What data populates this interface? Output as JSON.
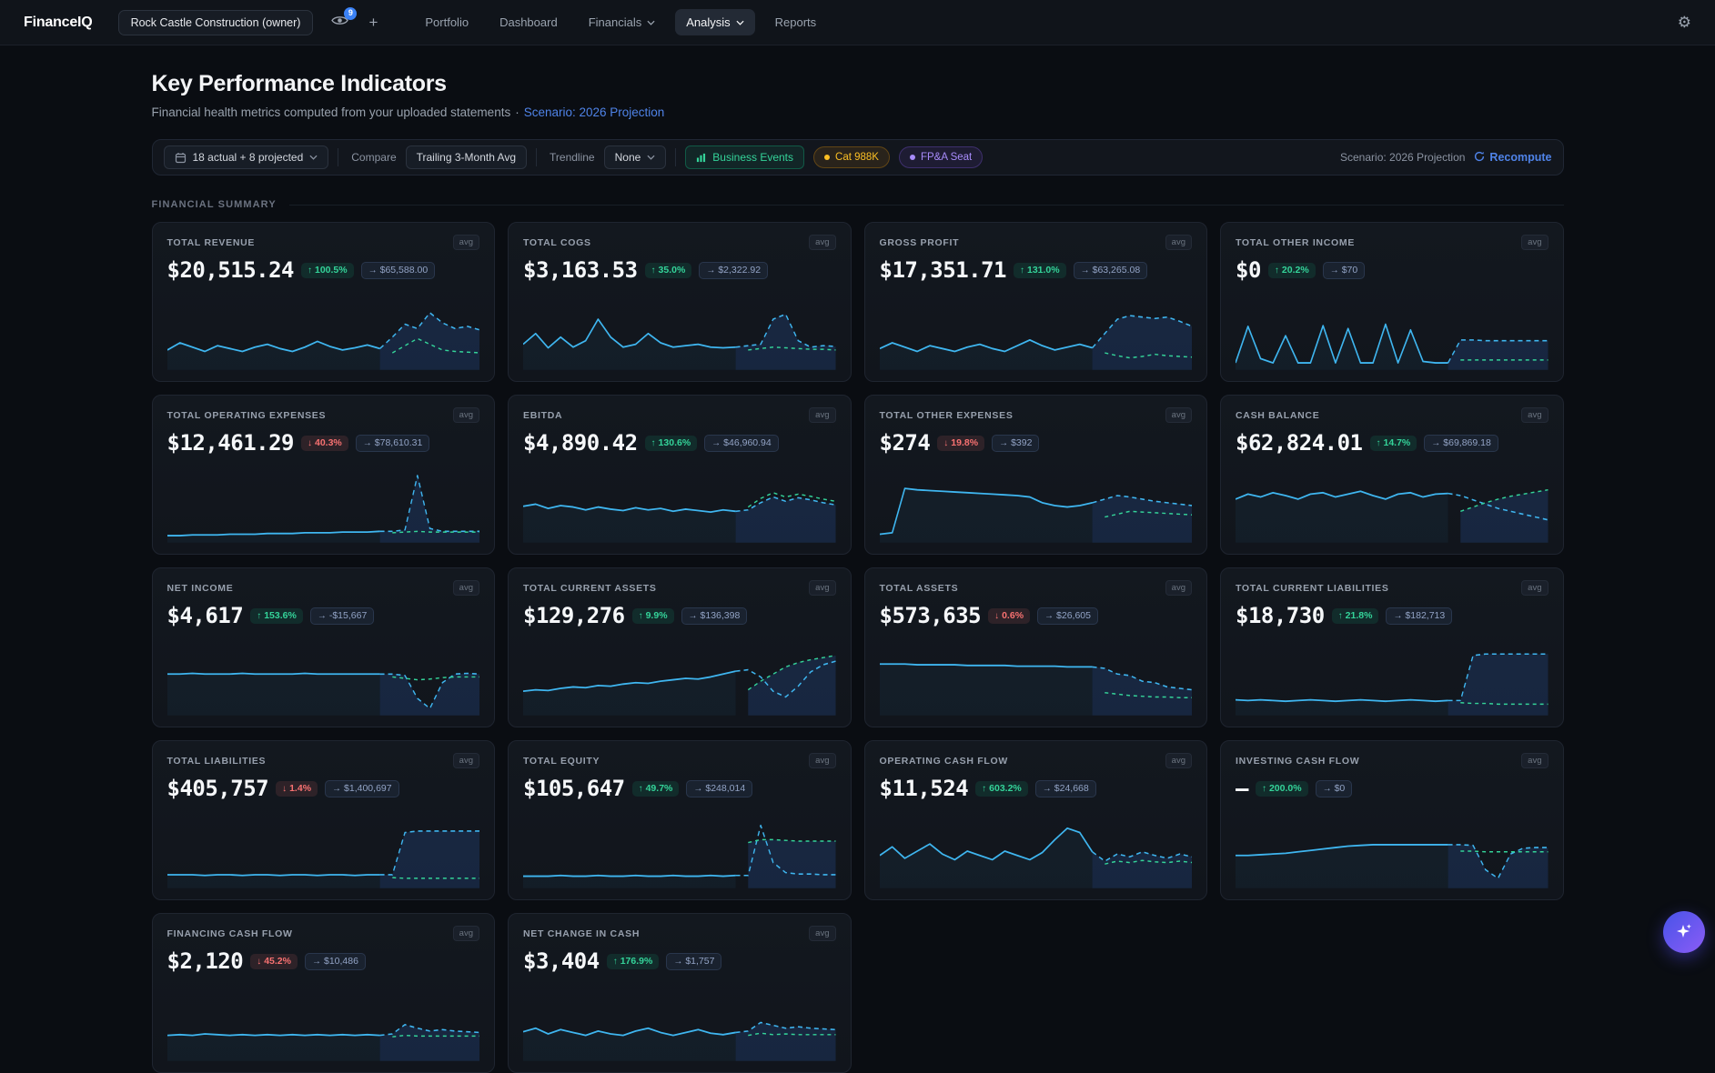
{
  "nav": {
    "brand": "FinanceIQ",
    "company": "Rock Castle Construction (owner)",
    "eye_badge": "9",
    "plus": "+",
    "items": [
      {
        "label": "Portfolio",
        "active": false,
        "caret": false
      },
      {
        "label": "Dashboard",
        "active": false,
        "caret": false
      },
      {
        "label": "Financials",
        "active": false,
        "caret": true
      },
      {
        "label": "Analysis",
        "active": true,
        "caret": true
      },
      {
        "label": "Reports",
        "active": false,
        "caret": false
      }
    ]
  },
  "header": {
    "title": "Key Performance Indicators",
    "subtitle": "Financial health metrics computed from your uploaded statements",
    "separator": "·",
    "scenario_link": "Scenario: 2026 Projection"
  },
  "toolbar": {
    "period": "18 actual + 8 projected",
    "compare_label": "Compare",
    "compare_value": "Trailing 3-Month Avg",
    "trendline_label": "Trendline",
    "trendline_value": "None",
    "business_events": "Business Events",
    "badge_cat": "Cat 988K",
    "badge_fpa": "FP&A Seat",
    "scenario_text": "Scenario: 2026 Projection",
    "recompute": "Recompute"
  },
  "section": {
    "label": "FINANCIAL SUMMARY"
  },
  "colors": {
    "accent_blue": "#4f83e8",
    "green": "#34d399",
    "red": "#f87171",
    "amber": "#fbbf24",
    "purple": "#a78bfa",
    "spark_cyan": "#3fb6f0",
    "spark_green": "#34d399",
    "proj_fill": "rgba(59,130,246,0.16)"
  },
  "cards": [
    {
      "title": "TOTAL REVENUE",
      "avg": "avg",
      "value": "$20,515.24",
      "change": {
        "dir": "up",
        "arrow": "↑",
        "label": "100.5%"
      },
      "compare": {
        "arrow": "→",
        "label": "$65,588.00"
      },
      "spark": {
        "actual": [
          22,
          32,
          26,
          20,
          28,
          24,
          20,
          26,
          30,
          24,
          20,
          26,
          34,
          27,
          22,
          25,
          29,
          24
        ],
        "proj": [
          40,
          58,
          52,
          74,
          60,
          52,
          55,
          50
        ],
        "green": [
          18,
          28,
          38,
          30,
          22,
          20,
          19,
          18
        ]
      }
    },
    {
      "title": "TOTAL COGS",
      "avg": "avg",
      "value": "$3,163.53",
      "change": {
        "dir": "up",
        "arrow": "↑",
        "label": "35.0%"
      },
      "compare": {
        "arrow": "→",
        "label": "$2,322.92"
      },
      "spark": {
        "actual": [
          30,
          45,
          25,
          40,
          26,
          35,
          65,
          40,
          26,
          30,
          45,
          32,
          26,
          28,
          30,
          26,
          25,
          26
        ],
        "proj": [
          28,
          30,
          65,
          72,
          35,
          26,
          28,
          27
        ],
        "green": [
          22,
          24,
          26,
          25,
          24,
          23,
          23,
          22
        ]
      }
    },
    {
      "title": "GROSS PROFIT",
      "avg": "avg",
      "value": "$17,351.71",
      "change": {
        "dir": "up",
        "arrow": "↑",
        "label": "131.0%"
      },
      "compare": {
        "arrow": "→",
        "label": "$63,265.08"
      },
      "spark": {
        "actual": [
          24,
          32,
          26,
          20,
          28,
          24,
          20,
          26,
          30,
          24,
          20,
          28,
          36,
          28,
          22,
          26,
          30,
          25
        ],
        "proj": [
          45,
          65,
          70,
          68,
          66,
          68,
          62,
          55
        ],
        "green": [
          18,
          14,
          11,
          13,
          16,
          14,
          13,
          12
        ]
      }
    },
    {
      "title": "TOTAL OTHER INCOME",
      "avg": "avg",
      "value": "$0",
      "change": {
        "dir": "up",
        "arrow": "↑",
        "label": "20.2%"
      },
      "compare": {
        "arrow": "→",
        "label": "$70"
      },
      "spark": {
        "actual": [
          4,
          55,
          10,
          4,
          42,
          4,
          4,
          56,
          4,
          52,
          4,
          4,
          58,
          4,
          50,
          6,
          4,
          4
        ],
        "proj": [
          36,
          36,
          35,
          35,
          35,
          35,
          35,
          35
        ],
        "green": [
          8,
          8,
          8,
          8,
          8,
          8,
          8,
          8
        ]
      }
    },
    {
      "title": "TOTAL OPERATING EXPENSES",
      "avg": "avg",
      "value": "$12,461.29",
      "change": {
        "dir": "down",
        "arrow": "↓",
        "label": "40.3%"
      },
      "compare": {
        "arrow": "→",
        "label": "$78,610.31"
      },
      "spark": {
        "actual": [
          4,
          4,
          5,
          5,
          5,
          6,
          6,
          6,
          7,
          7,
          7,
          8,
          8,
          8,
          9,
          9,
          9,
          10
        ],
        "proj": [
          10,
          12,
          88,
          14,
          10,
          10,
          10,
          10
        ],
        "green": [
          8,
          9,
          10,
          9,
          9,
          9,
          9,
          9
        ]
      }
    },
    {
      "title": "EBITDA",
      "avg": "avg",
      "value": "$4,890.42",
      "change": {
        "dir": "up",
        "arrow": "↑",
        "label": "130.6%"
      },
      "compare": {
        "arrow": "→",
        "label": "$46,960.94"
      },
      "spark": {
        "actual": [
          45,
          48,
          42,
          46,
          44,
          40,
          44,
          41,
          39,
          43,
          40,
          42,
          38,
          41,
          39,
          37,
          40,
          38
        ],
        "proj": [
          40,
          50,
          58,
          52,
          57,
          54,
          50,
          47
        ],
        "green": [
          44,
          56,
          64,
          58,
          62,
          59,
          55,
          52
        ]
      }
    },
    {
      "title": "TOTAL OTHER EXPENSES",
      "avg": "avg",
      "value": "$274",
      "change": {
        "dir": "down",
        "arrow": "↓",
        "label": "19.8%"
      },
      "compare": {
        "arrow": "→",
        "label": "$392"
      },
      "spark": {
        "actual": [
          6,
          8,
          70,
          68,
          67,
          66,
          65,
          64,
          63,
          62,
          61,
          60,
          58,
          50,
          46,
          44,
          46,
          50
        ],
        "proj": [
          55,
          60,
          58,
          55,
          52,
          50,
          48,
          46
        ],
        "green": [
          30,
          34,
          38,
          37,
          36,
          35,
          34,
          33
        ]
      }
    },
    {
      "title": "CASH BALANCE",
      "avg": "avg",
      "value": "$62,824.01",
      "change": {
        "dir": "up",
        "arrow": "↑",
        "label": "14.7%"
      },
      "compare": {
        "arrow": "→",
        "label": "$69,869.18"
      },
      "spark": {
        "actual": [
          55,
          62,
          58,
          64,
          60,
          55,
          62,
          64,
          58,
          62,
          66,
          60,
          55,
          62,
          64,
          58,
          62,
          63
        ],
        "proj": [
          60,
          54,
          48,
          42,
          38,
          34,
          30,
          26
        ],
        "green": [
          38,
          44,
          50,
          55,
          59,
          62,
          65,
          68
        ]
      }
    },
    {
      "title": "NET INCOME",
      "avg": "avg",
      "value": "$4,617",
      "change": {
        "dir": "up",
        "arrow": "↑",
        "label": "153.6%"
      },
      "compare": {
        "arrow": "→",
        "label": "-$15,667"
      },
      "spark": {
        "actual": [
          52,
          52,
          53,
          52,
          52,
          52,
          53,
          52,
          52,
          52,
          52,
          53,
          52,
          52,
          52,
          52,
          52,
          52
        ],
        "proj": [
          52,
          50,
          18,
          4,
          40,
          52,
          53,
          52
        ],
        "green": [
          48,
          46,
          44,
          45,
          47,
          48,
          48,
          48
        ]
      }
    },
    {
      "title": "TOTAL CURRENT ASSETS",
      "avg": "avg",
      "value": "$129,276",
      "change": {
        "dir": "up",
        "arrow": "↑",
        "label": "9.9%"
      },
      "compare": {
        "arrow": "→",
        "label": "$136,398"
      },
      "spark": {
        "actual": [
          28,
          30,
          29,
          32,
          34,
          33,
          36,
          35,
          38,
          40,
          39,
          42,
          44,
          46,
          45,
          48,
          52,
          56
        ],
        "proj": [
          58,
          48,
          28,
          20,
          35,
          55,
          65,
          70
        ],
        "green": [
          30,
          42,
          52,
          62,
          68,
          72,
          75,
          78
        ]
      }
    },
    {
      "title": "TOTAL ASSETS",
      "avg": "avg",
      "value": "$573,635",
      "change": {
        "dir": "down",
        "arrow": "↓",
        "label": "0.6%"
      },
      "compare": {
        "arrow": "→",
        "label": "$26,605"
      },
      "spark": {
        "actual": [
          66,
          66,
          66,
          65,
          65,
          65,
          65,
          64,
          64,
          64,
          64,
          63,
          63,
          63,
          63,
          62,
          62,
          62
        ],
        "proj": [
          60,
          52,
          50,
          42,
          40,
          34,
          32,
          30
        ],
        "green": [
          26,
          24,
          22,
          21,
          20,
          20,
          19,
          19
        ]
      }
    },
    {
      "title": "TOTAL CURRENT LIABILITIES",
      "avg": "avg",
      "value": "$18,730",
      "change": {
        "dir": "up",
        "arrow": "↑",
        "label": "21.8%"
      },
      "compare": {
        "arrow": "→",
        "label": "$182,713"
      },
      "spark": {
        "actual": [
          16,
          15,
          16,
          15,
          14,
          15,
          16,
          15,
          14,
          15,
          16,
          15,
          14,
          15,
          16,
          15,
          14,
          15
        ],
        "proj": [
          15,
          78,
          80,
          80,
          80,
          80,
          80,
          80
        ],
        "green": [
          12,
          11,
          11,
          10,
          10,
          10,
          10,
          10
        ]
      }
    },
    {
      "title": "TOTAL LIABILITIES",
      "avg": "avg",
      "value": "$405,757",
      "change": {
        "dir": "down",
        "arrow": "↓",
        "label": "1.4%"
      },
      "compare": {
        "arrow": "→",
        "label": "$1,400,697"
      },
      "spark": {
        "actual": [
          13,
          13,
          13,
          12,
          13,
          13,
          12,
          13,
          13,
          12,
          13,
          13,
          12,
          13,
          13,
          12,
          13,
          13
        ],
        "proj": [
          13,
          72,
          74,
          74,
          74,
          74,
          74,
          74
        ],
        "green": [
          9,
          8,
          8,
          8,
          8,
          8,
          8,
          8
        ]
      }
    },
    {
      "title": "TOTAL EQUITY",
      "avg": "avg",
      "value": "$105,647",
      "change": {
        "dir": "up",
        "arrow": "↑",
        "label": "49.7%"
      },
      "compare": {
        "arrow": "→",
        "label": "$248,014"
      },
      "spark": {
        "actual": [
          11,
          11,
          11,
          12,
          11,
          11,
          12,
          11,
          11,
          12,
          11,
          11,
          12,
          11,
          11,
          12,
          11,
          12
        ],
        "proj": [
          12,
          82,
          30,
          16,
          14,
          14,
          13,
          13
        ],
        "green": [
          58,
          62,
          62,
          61,
          60,
          60,
          60,
          60
        ]
      }
    },
    {
      "title": "OPERATING CASH FLOW",
      "avg": "avg",
      "value": "$11,524",
      "change": {
        "dir": "up",
        "arrow": "↑",
        "label": "603.2%"
      },
      "compare": {
        "arrow": "→",
        "label": "$24,668"
      },
      "spark": {
        "actual": [
          40,
          52,
          36,
          46,
          56,
          42,
          34,
          46,
          40,
          34,
          46,
          40,
          34,
          44,
          62,
          78,
          72,
          45
        ],
        "proj": [
          32,
          42,
          38,
          45,
          40,
          36,
          42,
          38
        ],
        "green": [
          28,
          32,
          30,
          33,
          31,
          30,
          32,
          30
        ]
      }
    },
    {
      "title": "INVESTING CASH FLOW",
      "avg": "avg",
      "value": "—",
      "change": {
        "dir": "up",
        "arrow": "↑",
        "label": "200.0%"
      },
      "compare": {
        "arrow": "→",
        "label": "$0"
      },
      "spark": {
        "actual": [
          40,
          40,
          41,
          42,
          43,
          45,
          47,
          49,
          51,
          53,
          54,
          55,
          55,
          55,
          55,
          55,
          55,
          55
        ],
        "proj": [
          55,
          54,
          20,
          8,
          42,
          50,
          51,
          51
        ],
        "green": [
          46,
          46,
          45,
          45,
          45,
          45,
          45,
          45
        ]
      }
    },
    {
      "title": "FINANCING CASH FLOW",
      "avg": "avg",
      "value": "$2,120",
      "change": {
        "dir": "down",
        "arrow": "↓",
        "label": "45.2%"
      },
      "compare": {
        "arrow": "→",
        "label": "$10,486"
      },
      "spark": {
        "actual": [
          30,
          31,
          30,
          32,
          31,
          30,
          31,
          30,
          31,
          30,
          31,
          30,
          31,
          30,
          31,
          30,
          31,
          30
        ],
        "proj": [
          32,
          45,
          40,
          36,
          38,
          36,
          35,
          34
        ],
        "green": [
          28,
          30,
          29,
          29,
          29,
          29,
          29,
          29
        ]
      }
    },
    {
      "title": "NET CHANGE IN CASH",
      "avg": "avg",
      "value": "$3,404",
      "change": {
        "dir": "up",
        "arrow": "↑",
        "label": "176.9%"
      },
      "compare": {
        "arrow": "→",
        "label": "$1,757"
      },
      "spark": {
        "actual": [
          35,
          40,
          32,
          38,
          34,
          30,
          36,
          32,
          30,
          36,
          40,
          34,
          30,
          34,
          38,
          33,
          31,
          34
        ],
        "proj": [
          36,
          48,
          44,
          40,
          42,
          40,
          39,
          38
        ],
        "green": [
          30,
          33,
          31,
          32,
          31,
          31,
          31,
          31
        ]
      }
    }
  ]
}
